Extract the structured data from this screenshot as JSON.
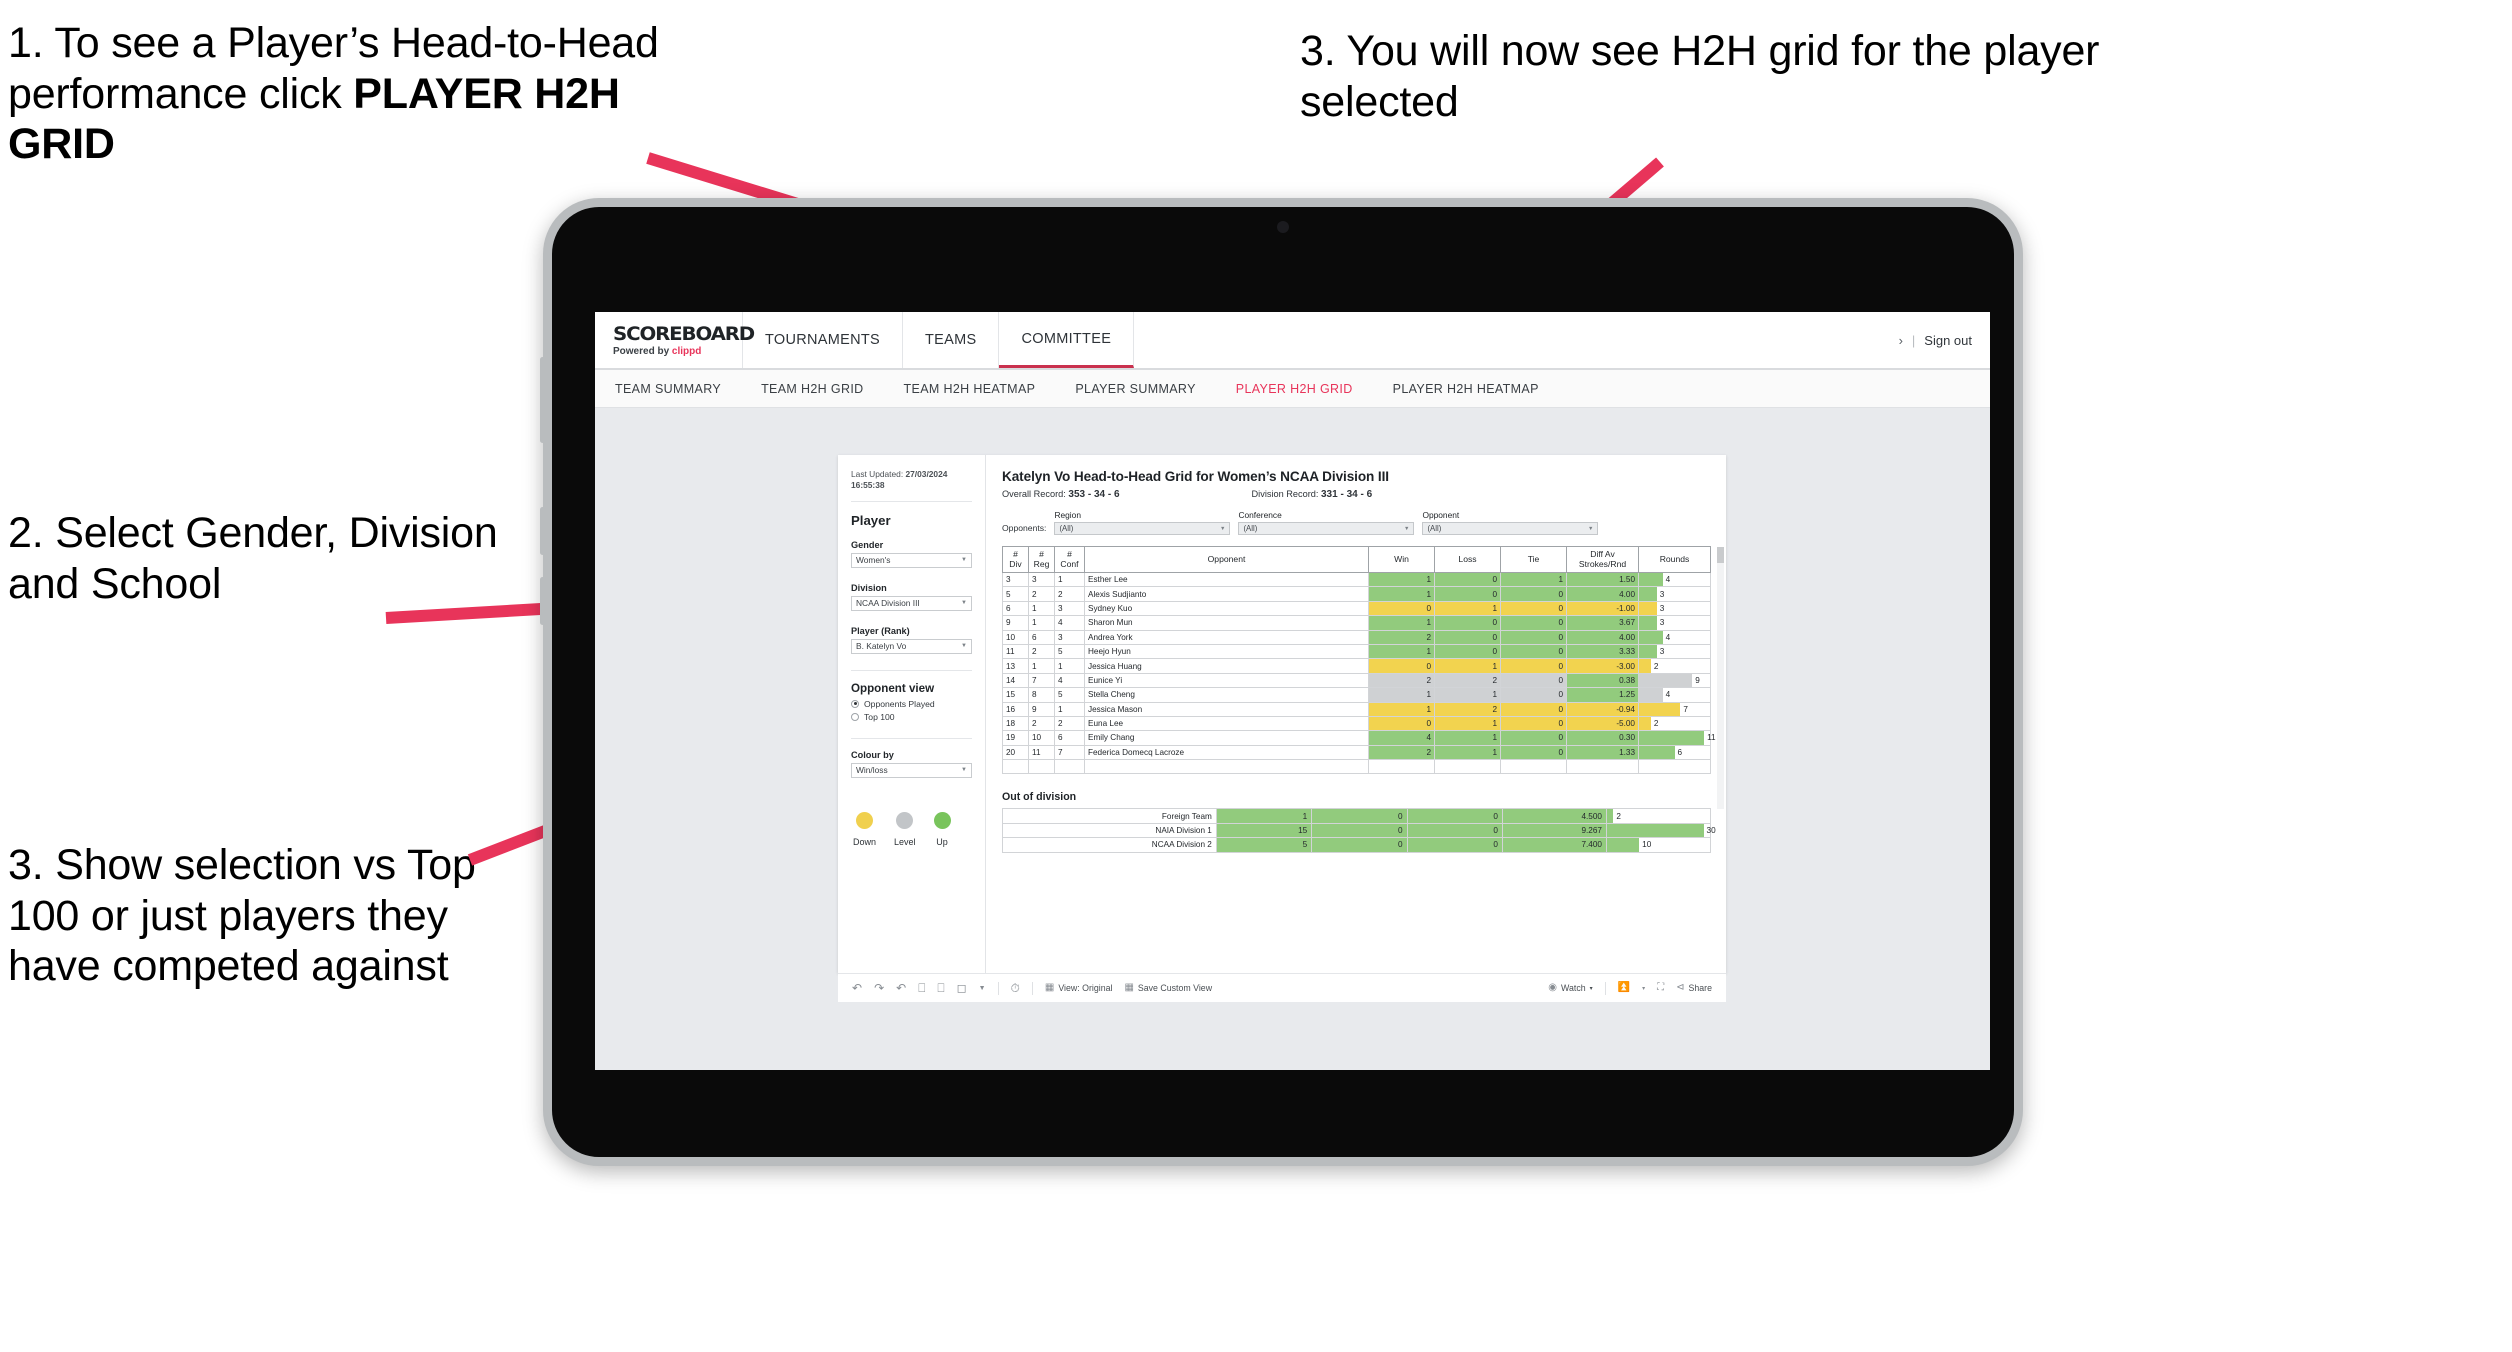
{
  "annotations": [
    {
      "id": "anno1",
      "plain": "1. To see a Player’s Head-to-Head performance click ",
      "bold": "PLAYER H2H GRID"
    },
    {
      "id": "anno2",
      "plain": "2. Select Gender, Division and School",
      "bold": ""
    },
    {
      "id": "anno3",
      "plain": "3. Show selection vs Top 100 or just players they have competed against",
      "bold": ""
    },
    {
      "id": "anno4",
      "plain": "3. You will now see H2H grid for the player selected",
      "bold": ""
    }
  ],
  "app": {
    "brand": {
      "name": "SCOREBOARD",
      "powered_prefix": "Powered by ",
      "powered_brand": "clippd"
    },
    "top_nav": [
      {
        "label": "TOURNAMENTS",
        "active": false
      },
      {
        "label": "TEAMS",
        "active": false
      },
      {
        "label": "COMMITTEE",
        "active": true
      }
    ],
    "account": {
      "chevron": "›",
      "separator": "|",
      "sign_out": "Sign out"
    },
    "sub_nav": [
      {
        "label": "TEAM SUMMARY",
        "active": false
      },
      {
        "label": "TEAM H2H GRID",
        "active": false
      },
      {
        "label": "TEAM H2H HEATMAP",
        "active": false
      },
      {
        "label": "PLAYER SUMMARY",
        "active": false
      },
      {
        "label": "PLAYER H2H GRID",
        "active": true
      },
      {
        "label": "PLAYER H2H HEATMAP",
        "active": false
      }
    ],
    "accent_color": "#e8345a"
  },
  "filters": {
    "last_updated_label": "Last Updated: ",
    "last_updated_date": "27/03/2024",
    "last_updated_time": "16:55:38",
    "section_title": "Player",
    "fields": [
      {
        "label": "Gender",
        "value": "Women's"
      },
      {
        "label": "Division",
        "value": "NCAA Division III"
      },
      {
        "label": "Player (Rank)",
        "value": "B. Katelyn Vo"
      }
    ],
    "opponent_view": {
      "title": "Opponent view",
      "options": [
        {
          "label": "Opponents Played",
          "selected": true
        },
        {
          "label": "Top 100",
          "selected": false
        }
      ]
    },
    "colour_by": {
      "label": "Colour by",
      "value": "Win/loss"
    },
    "legend": [
      {
        "label": "Down",
        "color": "#f0d04e"
      },
      {
        "label": "Level",
        "color": "#c2c5c8"
      },
      {
        "label": "Up",
        "color": "#79c45c"
      }
    ]
  },
  "main": {
    "title": "Katelyn Vo Head-to-Head Grid for Women’s NCAA Division III",
    "overall_record_label": "Overall Record: ",
    "overall_record_value": "353 -  34 - 6",
    "division_record_label": "Division Record: ",
    "division_record_value": "331 -  34 - 6",
    "opponents_label": "Opponents:",
    "opponent_filters": [
      {
        "caption": "Region",
        "value": "(All)"
      },
      {
        "caption": "Conference",
        "value": "(All)"
      },
      {
        "caption": "Opponent",
        "value": "(All)"
      }
    ],
    "out_of_division_title": "Out of division"
  },
  "chart_data": {
    "type": "table",
    "title": "Katelyn Vo Head-to-Head Grid for Women’s NCAA Division III",
    "columns": [
      "# Div",
      "# Reg",
      "# Conf",
      "Opponent",
      "Win",
      "Loss",
      "Tie",
      "Diff Av Strokes/Rnd",
      "Rounds"
    ],
    "column_headers_multiline": [
      [
        "#",
        "Div"
      ],
      [
        "#",
        "Reg"
      ],
      [
        "#",
        "Conf"
      ],
      [
        "Opponent"
      ],
      [
        "Win"
      ],
      [
        "Loss"
      ],
      [
        "Tie"
      ],
      [
        "Diff Av",
        "Strokes/Rnd"
      ],
      [
        "Rounds"
      ]
    ],
    "rounds_max": 12,
    "rows": [
      {
        "div": "3",
        "reg": "3",
        "conf": "1",
        "opponent": "Esther Lee",
        "win": "1",
        "loss": "0",
        "tie": "1",
        "diff": "1.50",
        "rounds": "4",
        "color": "green"
      },
      {
        "div": "5",
        "reg": "2",
        "conf": "2",
        "opponent": "Alexis Sudjianto",
        "win": "1",
        "loss": "0",
        "tie": "0",
        "diff": "4.00",
        "rounds": "3",
        "color": "green"
      },
      {
        "div": "6",
        "reg": "1",
        "conf": "3",
        "opponent": "Sydney Kuo",
        "win": "0",
        "loss": "1",
        "tie": "0",
        "diff": "-1.00",
        "rounds": "3",
        "color": "yellow"
      },
      {
        "div": "9",
        "reg": "1",
        "conf": "4",
        "opponent": "Sharon Mun",
        "win": "1",
        "loss": "0",
        "tie": "0",
        "diff": "3.67",
        "rounds": "3",
        "color": "green"
      },
      {
        "div": "10",
        "reg": "6",
        "conf": "3",
        "opponent": "Andrea York",
        "win": "2",
        "loss": "0",
        "tie": "0",
        "diff": "4.00",
        "rounds": "4",
        "color": "green"
      },
      {
        "div": "11",
        "reg": "2",
        "conf": "5",
        "opponent": "Heejo Hyun",
        "win": "1",
        "loss": "0",
        "tie": "0",
        "diff": "3.33",
        "rounds": "3",
        "color": "green"
      },
      {
        "div": "13",
        "reg": "1",
        "conf": "1",
        "opponent": "Jessica Huang",
        "win": "0",
        "loss": "1",
        "tie": "0",
        "diff": "-3.00",
        "rounds": "2",
        "color": "yellow"
      },
      {
        "div": "14",
        "reg": "7",
        "conf": "4",
        "opponent": "Eunice Yi",
        "win": "2",
        "loss": "2",
        "tie": "0",
        "diff": "0.38",
        "rounds": "9",
        "color": "grey",
        "diff_color": "green"
      },
      {
        "div": "15",
        "reg": "8",
        "conf": "5",
        "opponent": "Stella Cheng",
        "win": "1",
        "loss": "1",
        "tie": "0",
        "diff": "1.25",
        "rounds": "4",
        "color": "grey",
        "diff_color": "green"
      },
      {
        "div": "16",
        "reg": "9",
        "conf": "1",
        "opponent": "Jessica Mason",
        "win": "1",
        "loss": "2",
        "tie": "0",
        "diff": "-0.94",
        "rounds": "7",
        "color": "yellow"
      },
      {
        "div": "18",
        "reg": "2",
        "conf": "2",
        "opponent": "Euna Lee",
        "win": "0",
        "loss": "1",
        "tie": "0",
        "diff": "-5.00",
        "rounds": "2",
        "color": "yellow"
      },
      {
        "div": "19",
        "reg": "10",
        "conf": "6",
        "opponent": "Emily Chang",
        "win": "4",
        "loss": "1",
        "tie": "0",
        "diff": "0.30",
        "rounds": "11",
        "color": "green"
      },
      {
        "div": "20",
        "reg": "11",
        "conf": "7",
        "opponent": "Federica Domecq Lacroze",
        "win": "2",
        "loss": "1",
        "tie": "0",
        "diff": "1.33",
        "rounds": "6",
        "color": "green"
      }
    ],
    "out_of_division": {
      "rounds_max": 32,
      "rows": [
        {
          "name": "Foreign Team",
          "win": "1",
          "loss": "0",
          "tie": "0",
          "diff": "4.500",
          "rounds": "2",
          "color": "green"
        },
        {
          "name": "NAIA Division 1",
          "win": "15",
          "loss": "0",
          "tie": "0",
          "diff": "9.267",
          "rounds": "30",
          "color": "green"
        },
        {
          "name": "NCAA Division 2",
          "win": "5",
          "loss": "0",
          "tie": "0",
          "diff": "7.400",
          "rounds": "10",
          "color": "green"
        }
      ]
    },
    "colors": {
      "green": "#92cb7d",
      "yellow": "#f2d34f",
      "grey": "#cfd1d3"
    }
  },
  "toolbar": {
    "icons": [
      "undo-icon",
      "redo-icon",
      "revert-icon",
      "refresh-icon",
      "pause-icon",
      "layout-icon",
      "chevron-down-icon"
    ],
    "clock_icon": "clock-icon",
    "view_icon": "view-original-icon",
    "view_label": "View: Original",
    "save_icon": "save-custom-view-icon",
    "save_label": "Save Custom View",
    "watch_icon": "eye-icon",
    "watch_label": "Watch",
    "watch_caret": "▾",
    "download_icon": "download-icon",
    "download_caret": "▾",
    "fullscreen_icon": "fullscreen-icon",
    "share_icon": "share-icon",
    "share_label": "Share"
  }
}
